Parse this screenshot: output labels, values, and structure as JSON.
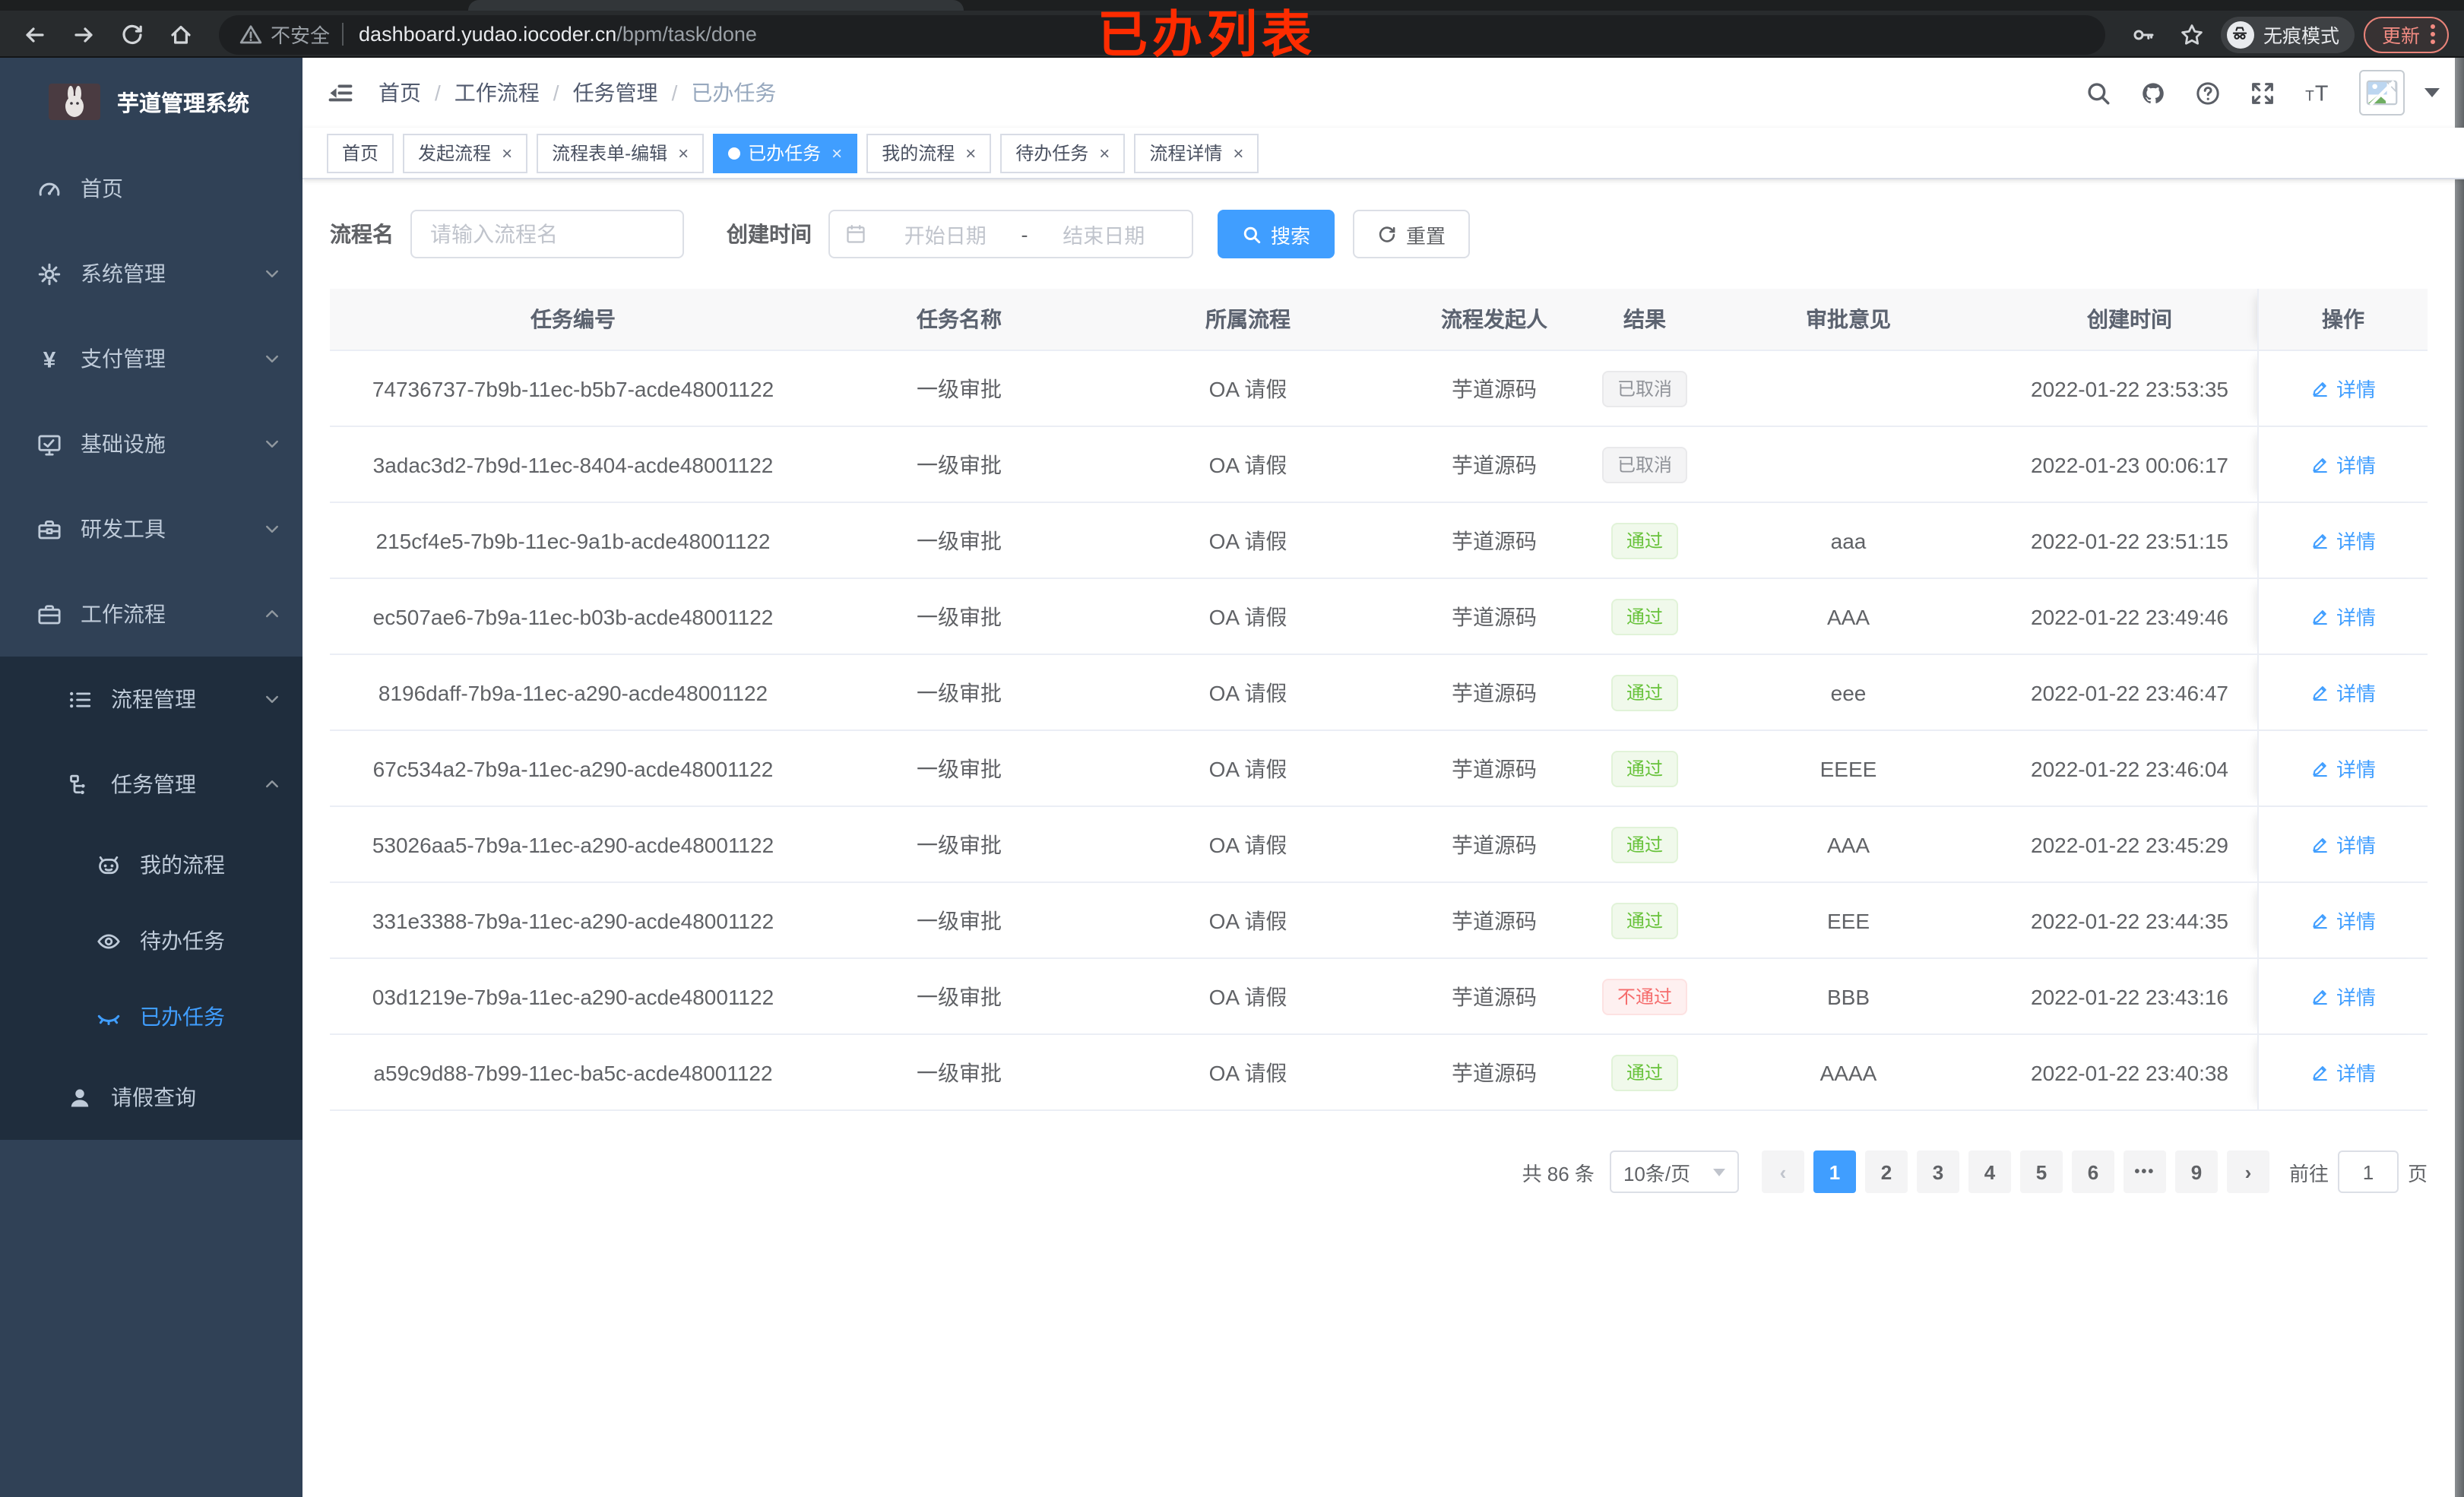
{
  "browser": {
    "security_label": "不安全",
    "url_host": "dashboard.yudao.iocoder.cn",
    "url_path": "/bpm/task/done",
    "incognito_label": "无痕模式",
    "update_label": "更新"
  },
  "annotation": "已办列表",
  "sidebar": {
    "title": "芋道管理系统",
    "menu": [
      {
        "key": "home",
        "label": "首页",
        "icon": "gauge-icon",
        "level": 1
      },
      {
        "key": "system",
        "label": "系统管理",
        "icon": "gear-icon",
        "level": 1,
        "chevron": "down"
      },
      {
        "key": "payment",
        "label": "支付管理",
        "icon": "yen-icon",
        "level": 1,
        "chevron": "down"
      },
      {
        "key": "infra",
        "label": "基础设施",
        "icon": "monitor-icon",
        "level": 1,
        "chevron": "down"
      },
      {
        "key": "dev-tools",
        "label": "研发工具",
        "icon": "toolbox-icon",
        "level": 1,
        "chevron": "down"
      },
      {
        "key": "workflow",
        "label": "工作流程",
        "icon": "briefcase-icon",
        "level": 1,
        "chevron": "up"
      },
      {
        "key": "process-mgmt",
        "label": "流程管理",
        "icon": "tree-icon",
        "level": 2,
        "chevron": "down",
        "sub": true
      },
      {
        "key": "task-mgmt",
        "label": "任务管理",
        "icon": "flow-icon",
        "level": 2,
        "chevron": "up",
        "sub": true
      },
      {
        "key": "my-process",
        "label": "我的流程",
        "icon": "face-icon",
        "level": 3,
        "sub": true
      },
      {
        "key": "todo-tasks",
        "label": "待办任务",
        "icon": "eye-icon",
        "level": 3,
        "sub": true
      },
      {
        "key": "done-tasks",
        "label": "已办任务",
        "icon": "eye-closed-icon",
        "level": 3,
        "sub": true,
        "active": true
      },
      {
        "key": "leave-query",
        "label": "请假查询",
        "icon": "user-icon",
        "level": 2,
        "sub": true
      }
    ]
  },
  "navbar": {
    "breadcrumb": [
      "首页",
      "工作流程",
      "任务管理",
      "已办任务"
    ]
  },
  "tabs": [
    {
      "key": "home",
      "label": "首页",
      "closable": false,
      "active": false
    },
    {
      "key": "start-process",
      "label": "发起流程",
      "closable": true,
      "active": false
    },
    {
      "key": "form-edit",
      "label": "流程表单-编辑",
      "closable": true,
      "active": false
    },
    {
      "key": "done-tasks",
      "label": "已办任务",
      "closable": true,
      "active": true
    },
    {
      "key": "my-process",
      "label": "我的流程",
      "closable": true,
      "active": false
    },
    {
      "key": "todo-tasks",
      "label": "待办任务",
      "closable": true,
      "active": false
    },
    {
      "key": "process-detail",
      "label": "流程详情",
      "closable": true,
      "active": false
    }
  ],
  "filters": {
    "name_label": "流程名",
    "name_placeholder": "请输入流程名",
    "date_label": "创建时间",
    "date_start_placeholder": "开始日期",
    "date_separator": "-",
    "date_end_placeholder": "结束日期",
    "search_label": "搜索",
    "reset_label": "重置"
  },
  "table": {
    "columns": [
      "任务编号",
      "任务名称",
      "所属流程",
      "流程发起人",
      "结果",
      "审批意见",
      "创建时间",
      "操作"
    ],
    "action_label": "详情",
    "rows": [
      {
        "id": "74736737-7b9b-11ec-b5b7-acde48001122",
        "name": "一级审批",
        "process": "OA 请假",
        "starter": "芋道源码",
        "result": "已取消",
        "result_type": "info",
        "comment": "",
        "time": "2022-01-22 23:53:35"
      },
      {
        "id": "3adac3d2-7b9d-11ec-8404-acde48001122",
        "name": "一级审批",
        "process": "OA 请假",
        "starter": "芋道源码",
        "result": "已取消",
        "result_type": "info",
        "comment": "",
        "time": "2022-01-23 00:06:17"
      },
      {
        "id": "215cf4e5-7b9b-11ec-9a1b-acde48001122",
        "name": "一级审批",
        "process": "OA 请假",
        "starter": "芋道源码",
        "result": "通过",
        "result_type": "success",
        "comment": "aaa",
        "time": "2022-01-22 23:51:15"
      },
      {
        "id": "ec507ae6-7b9a-11ec-b03b-acde48001122",
        "name": "一级审批",
        "process": "OA 请假",
        "starter": "芋道源码",
        "result": "通过",
        "result_type": "success",
        "comment": "AAA",
        "time": "2022-01-22 23:49:46"
      },
      {
        "id": "8196daff-7b9a-11ec-a290-acde48001122",
        "name": "一级审批",
        "process": "OA 请假",
        "starter": "芋道源码",
        "result": "通过",
        "result_type": "success",
        "comment": "eee",
        "time": "2022-01-22 23:46:47"
      },
      {
        "id": "67c534a2-7b9a-11ec-a290-acde48001122",
        "name": "一级审批",
        "process": "OA 请假",
        "starter": "芋道源码",
        "result": "通过",
        "result_type": "success",
        "comment": "EEEE",
        "time": "2022-01-22 23:46:04"
      },
      {
        "id": "53026aa5-7b9a-11ec-a290-acde48001122",
        "name": "一级审批",
        "process": "OA 请假",
        "starter": "芋道源码",
        "result": "通过",
        "result_type": "success",
        "comment": "AAA",
        "time": "2022-01-22 23:45:29"
      },
      {
        "id": "331e3388-7b9a-11ec-a290-acde48001122",
        "name": "一级审批",
        "process": "OA 请假",
        "starter": "芋道源码",
        "result": "通过",
        "result_type": "success",
        "comment": "EEE",
        "time": "2022-01-22 23:44:35"
      },
      {
        "id": "03d1219e-7b9a-11ec-a290-acde48001122",
        "name": "一级审批",
        "process": "OA 请假",
        "starter": "芋道源码",
        "result": "不通过",
        "result_type": "danger",
        "comment": "BBB",
        "time": "2022-01-22 23:43:16"
      },
      {
        "id": "a59c9d88-7b99-11ec-ba5c-acde48001122",
        "name": "一级审批",
        "process": "OA 请假",
        "starter": "芋道源码",
        "result": "通过",
        "result_type": "success",
        "comment": "AAAA",
        "time": "2022-01-22 23:40:38"
      }
    ]
  },
  "pagination": {
    "total_text": "共 86 条",
    "page_size": "10条/页",
    "pages": [
      "1",
      "2",
      "3",
      "4",
      "5",
      "6",
      "•••",
      "9"
    ],
    "active_page": "1",
    "goto_label": "前往",
    "goto_value": "1",
    "page_unit": "页"
  },
  "colors": {
    "primary": "#409eff",
    "success": "#67c23a",
    "danger": "#f56c6c",
    "info": "#909399",
    "sidebar_bg": "#304156",
    "submenu_bg": "#1f2d3d",
    "annotation_red": "#fe2c00"
  }
}
